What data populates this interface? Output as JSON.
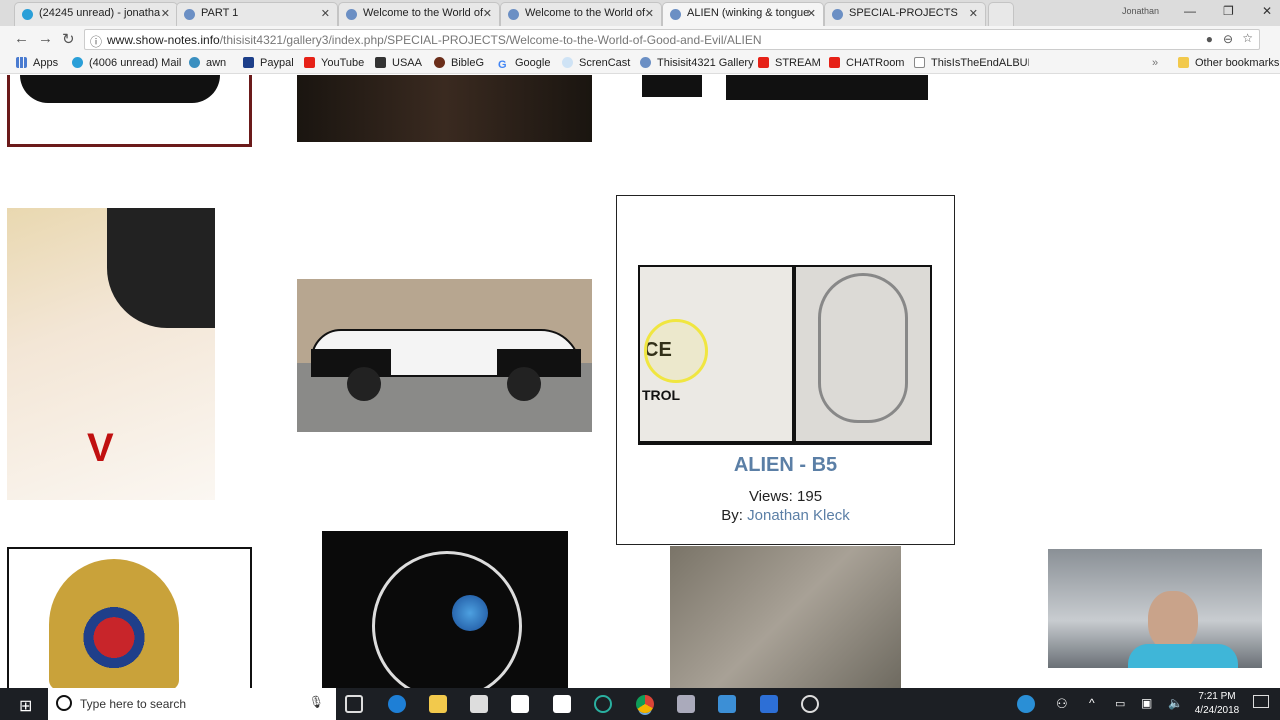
{
  "browser": {
    "tabs": [
      {
        "label": "(24245 unread) - jonatha",
        "active": false
      },
      {
        "label": "PART 1",
        "active": false
      },
      {
        "label": "Welcome to the World of",
        "active": false
      },
      {
        "label": "Welcome to the World of",
        "active": false
      },
      {
        "label": "ALIEN (winking & tongue",
        "active": true
      },
      {
        "label": "SPECIAL-PROJECTS",
        "active": false
      }
    ],
    "profile": "Jonathan",
    "url_host": "www.show-notes.info",
    "url_path": "/thisisit4321/gallery3/index.php/SPECIAL-PROJECTS/Welcome-to-the-World-of-Good-and-Evil/ALIEN",
    "bookmarks": [
      "Apps",
      "(4006 unread) Mail",
      "awn",
      "Paypal",
      "YouTube",
      "USAA",
      "BibleG",
      "Google",
      "ScrenCast",
      "Thisisit4321 Gallery",
      "STREAM",
      "CHATRoom",
      "ThisIsTheEndALBUM"
    ],
    "other_bookmarks": "Other bookmarks",
    "overflow": "»"
  },
  "card": {
    "title": "ALIEN - B5",
    "views_label": "Views:",
    "views": "195",
    "by_label": "By:",
    "author": "Jonathan Kleck",
    "accent": "#5b7fa6"
  },
  "taskbar": {
    "search_placeholder": "Type here to search",
    "time": "7:21 PM",
    "date": "4/24/2018"
  }
}
